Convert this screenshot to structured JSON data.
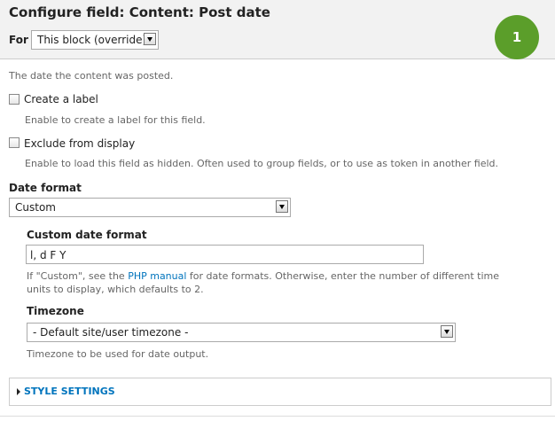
{
  "header": {
    "title": "Configure field: Content: Post date",
    "for_label": "For",
    "for_value": "This block (override)",
    "badge": "1"
  },
  "field_description": "The date the content was posted.",
  "create_label": {
    "label": "Create a label",
    "description": "Enable to create a label for this field.",
    "checked": false
  },
  "exclude": {
    "label": "Exclude from display",
    "description": "Enable to load this field as hidden. Often used to group fields, or to use as token in another field.",
    "checked": false
  },
  "date_format": {
    "label": "Date format",
    "value": "Custom"
  },
  "custom_format": {
    "label": "Custom date format",
    "value": "l, d F Y",
    "help_before": "If \"Custom\", see the ",
    "help_link": "PHP manual",
    "help_after": " for date formats. Otherwise, enter the number of different time",
    "help_line2": "units to display, which defaults to 2."
  },
  "timezone": {
    "label": "Timezone",
    "value": "- Default site/user timezone -",
    "description": "Timezone to be used for date output."
  },
  "style_settings": {
    "title": "STYLE SETTINGS"
  }
}
